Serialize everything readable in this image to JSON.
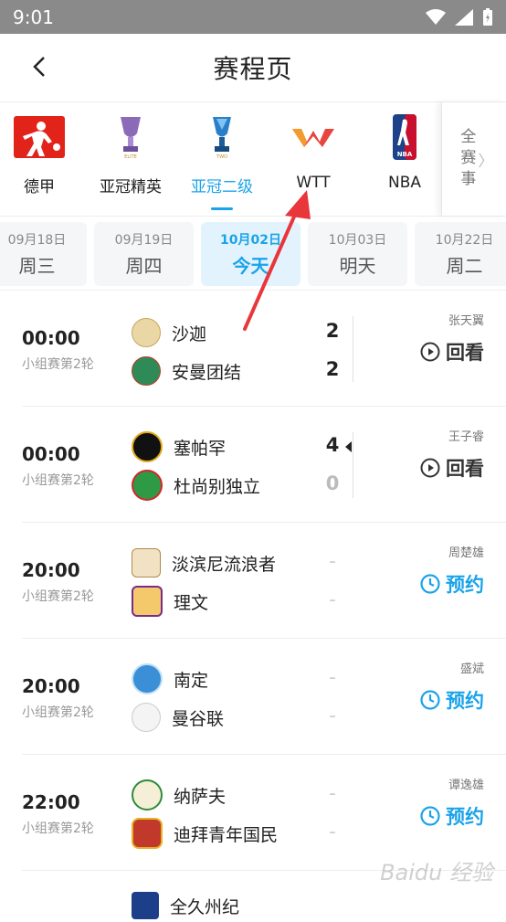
{
  "status_bar": {
    "time": "9:01"
  },
  "header": {
    "title": "赛程页"
  },
  "leagues": [
    {
      "name": "德甲"
    },
    {
      "name": "亚冠精英"
    },
    {
      "name": "亚冠二级"
    },
    {
      "name": "WTT"
    },
    {
      "name": "NBA"
    }
  ],
  "leagues_more": "全赛事",
  "dates": [
    {
      "date": "09月18日",
      "weekday": "周三"
    },
    {
      "date": "09月19日",
      "weekday": "周四"
    },
    {
      "date": "10月02日",
      "weekday": "今天"
    },
    {
      "date": "10月03日",
      "weekday": "明天"
    },
    {
      "date": "10月22日",
      "weekday": "周二"
    }
  ],
  "matches": [
    {
      "time": "00:00",
      "round": "小组赛第2轮",
      "home": "沙迦",
      "away": "安曼团结",
      "home_score": "2",
      "away_score": "2",
      "commentator": "张天翼",
      "action": "回看"
    },
    {
      "time": "00:00",
      "round": "小组赛第2轮",
      "home": "塞帕罕",
      "away": "杜尚别独立",
      "home_score": "4",
      "away_score": "0",
      "commentator": "王子睿",
      "action": "回看"
    },
    {
      "time": "20:00",
      "round": "小组赛第2轮",
      "home": "淡滨尼流浪者",
      "away": "理文",
      "home_score": "-",
      "away_score": "-",
      "commentator": "周楚雄",
      "action": "预约"
    },
    {
      "time": "20:00",
      "round": "小组赛第2轮",
      "home": "南定",
      "away": "曼谷联",
      "home_score": "-",
      "away_score": "-",
      "commentator": "盛斌",
      "action": "预约"
    },
    {
      "time": "22:00",
      "round": "小组赛第2轮",
      "home": "纳萨夫",
      "away": "迪拜青年国民",
      "home_score": "-",
      "away_score": "-",
      "commentator": "谭逸雄",
      "action": "预约"
    }
  ],
  "partial_row": {
    "home": "全久州纪"
  },
  "watermark": "Baidu 经验",
  "colors": {
    "accent": "#1aa3ea",
    "arrow": "#e8363b",
    "status_bar": "#8a8a8a"
  }
}
